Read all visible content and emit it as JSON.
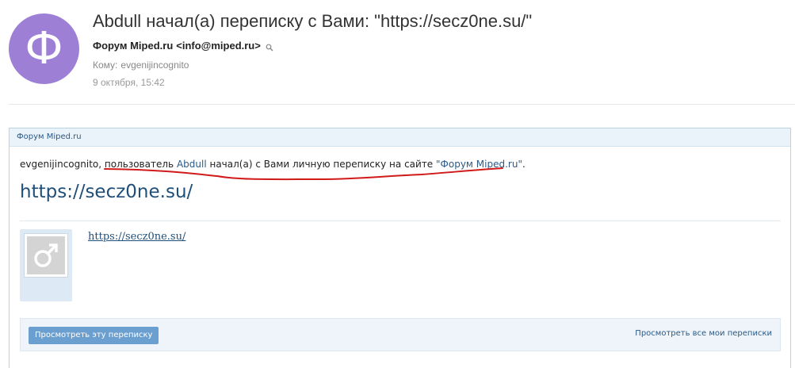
{
  "email": {
    "avatar_letter": "Ф",
    "avatar_color": "#9e7fd6",
    "subject": "Abdull начал(а) переписку с Вами: \"https://secz0ne.su/\"",
    "sender_name": "Форум Miped.ru",
    "sender_email": "<info@miped.ru>",
    "to_label": "Кому:",
    "to_value": "evgenijincognito",
    "date": "9 октября, 15:42"
  },
  "forum": {
    "header_title": "Форум Miped.ru",
    "intro": {
      "username": "evgenijincognito",
      "comma": ",",
      "part1": "пользователь",
      "sender": "Abdull",
      "part2": "начал(а) с Вами личную переписку на сайте",
      "site_link": "\"Форум Miped.ru\"",
      "end": "."
    },
    "conversation_title": "https://secz0ne.su/",
    "message_link": "https://secz0ne.su/",
    "avatar_icon": "male-symbol-icon",
    "view_button": "Просмотреть эту переписку",
    "view_all_link": "Просмотреть все мои переписки",
    "accent_color": "#2a5a86",
    "button_color": "#6b9fd0",
    "annotation_color": "#d11a1a"
  }
}
